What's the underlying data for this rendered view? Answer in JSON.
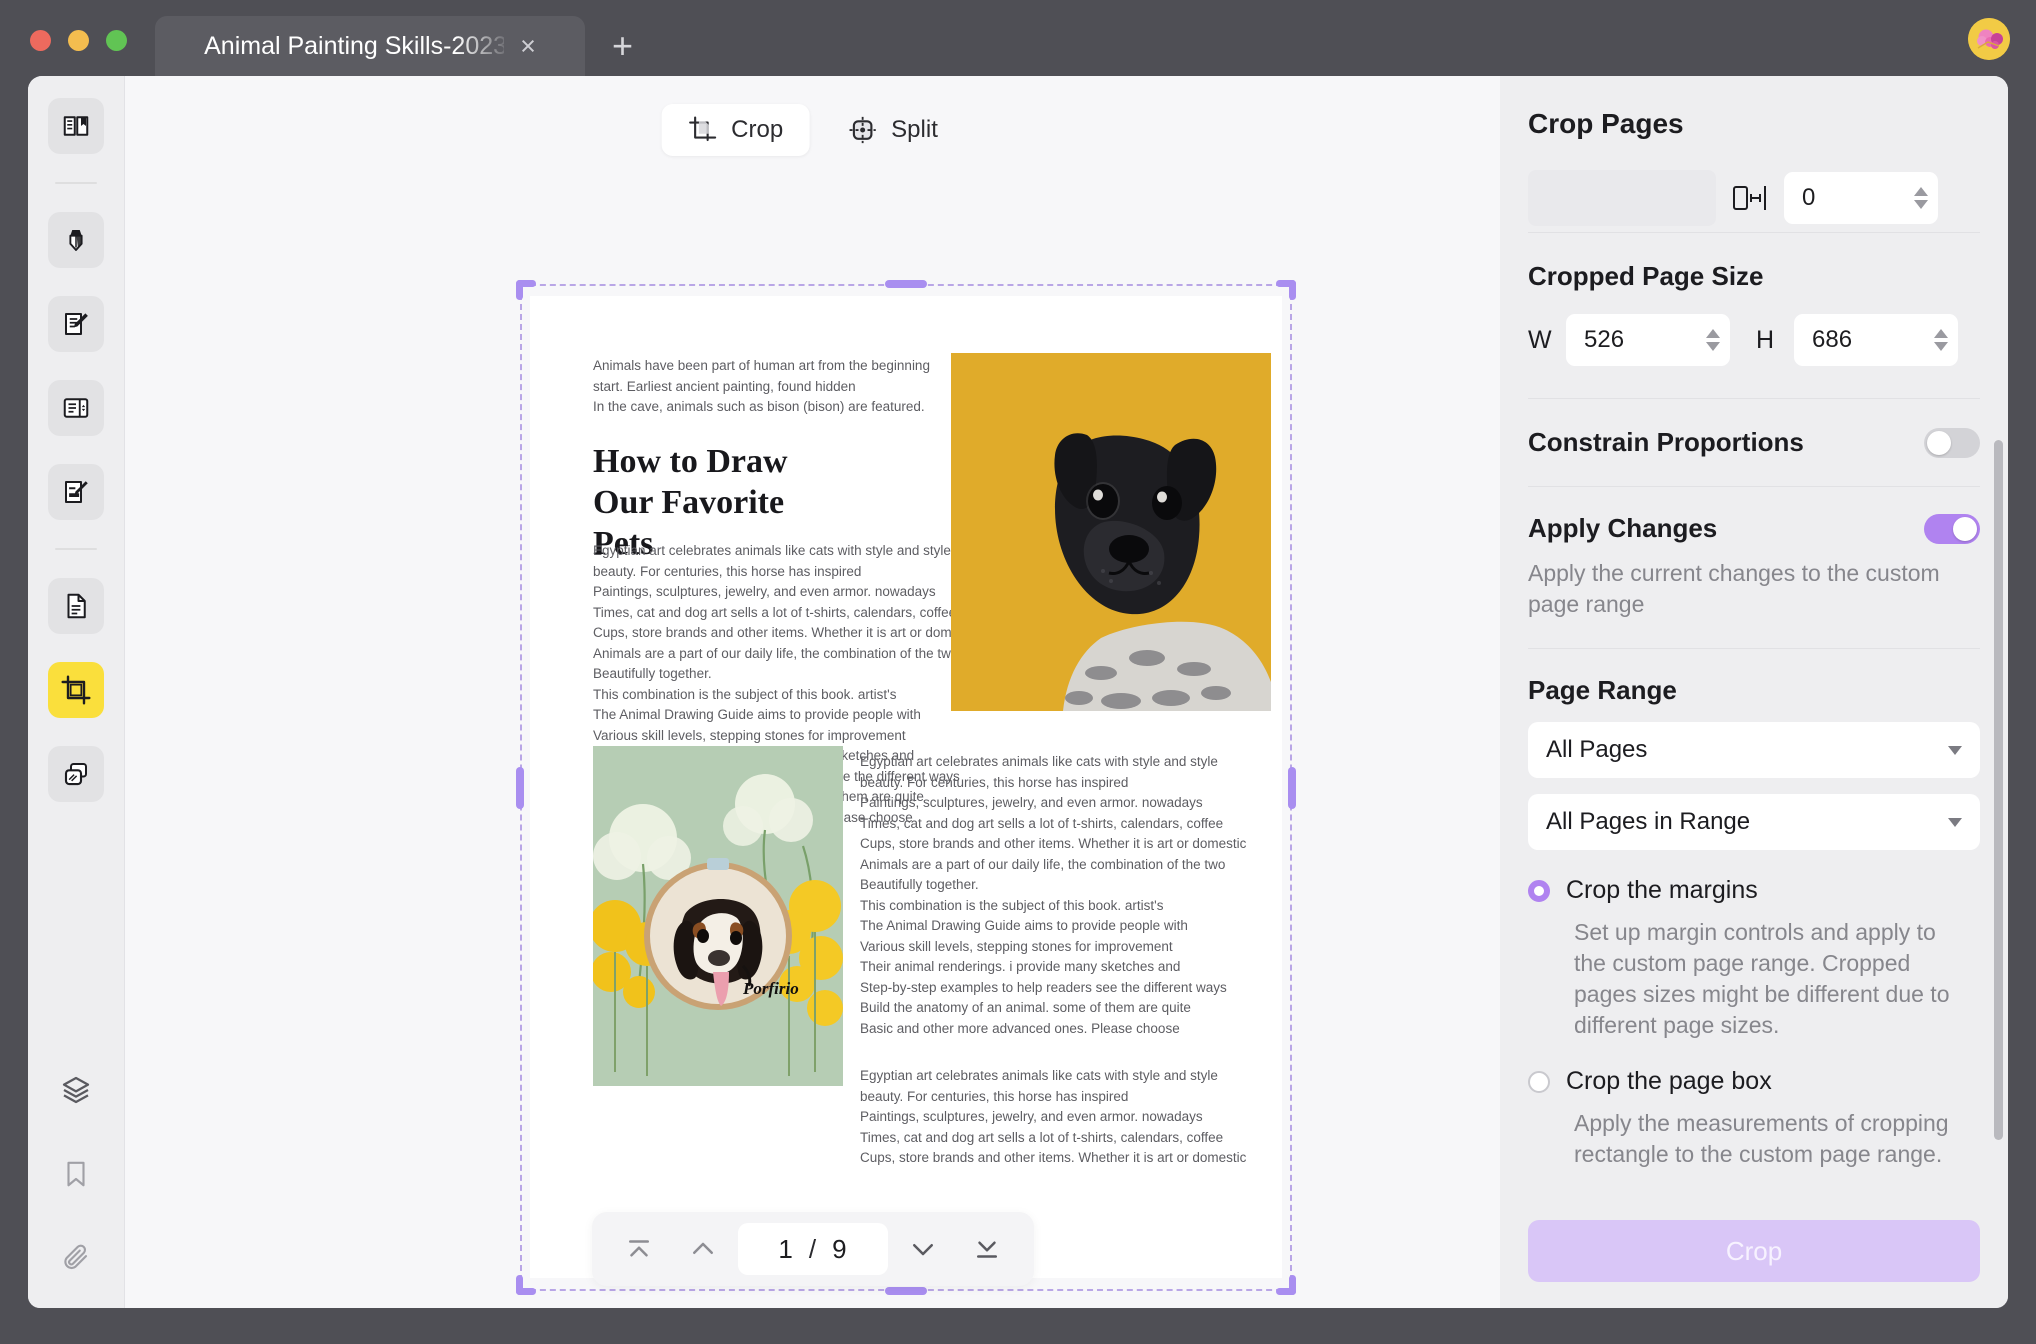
{
  "window": {
    "tab_title": "Animal Painting Skills-2023",
    "close_label": "×",
    "new_tab_label": "+"
  },
  "sidebar": {
    "items": [
      {
        "name": "reader-icon",
        "label": "Reader"
      },
      {
        "name": "highlighter-icon",
        "label": "Highlight"
      },
      {
        "name": "edit-text-icon",
        "label": "Edit Text"
      },
      {
        "name": "form-icon",
        "label": "Form"
      },
      {
        "name": "sign-icon",
        "label": "Sign"
      },
      {
        "name": "page-organize-icon",
        "label": "Organize Pages"
      },
      {
        "name": "crop-icon",
        "label": "Crop"
      },
      {
        "name": "background-icon",
        "label": "Background"
      },
      {
        "name": "layers-icon",
        "label": "Layers"
      },
      {
        "name": "bookmark-icon",
        "label": "Bookmarks"
      },
      {
        "name": "attachment-icon",
        "label": "Attachments"
      }
    ],
    "active_index": 6
  },
  "toolbar": {
    "crop_label": "Crop",
    "split_label": "Split",
    "active_mode": "Crop"
  },
  "document": {
    "intro_lines": [
      "Animals have been part of human art from the beginning",
      "start. Earliest ancient painting, found hidden",
      "In the cave, animals such as bison (bison) are featured."
    ],
    "title": "How to Draw Our Favorite Pets",
    "body_lines": [
      "Egyptian art celebrates animals like cats with style and style",
      "beauty. For centuries, this horse has inspired",
      "Paintings, sculptures, jewelry, and even armor. nowadays",
      "Times, cat and dog art sells a lot of t-shirts, calendars, coffee",
      "Cups, store brands and other items. Whether it is art or domestic",
      "Animals are a part of our daily life, the combination of the two",
      "Beautifully together.",
      "This combination is the subject of this book. artist's",
      "The Animal Drawing Guide aims to provide people with",
      "Various skill levels, stepping stones for improvement",
      "Their animal renderings. I provide many sketches and",
      "Step-by-step examples to help readers see the different ways",
      "Build the anatomy of an animal. some of them are quite",
      "Basic and other more advanced ones. Please choose"
    ],
    "lower_right_lines": [
      "Egyptian art celebrates animals like cats with style and style",
      "beauty. For centuries, this horse has inspired",
      "Paintings, sculptures, jewelry, and even armor. nowadays",
      "Times, cat and dog art sells a lot of t-shirts, calendars, coffee",
      "Cups, store brands and other items. Whether it is art or domestic",
      "Animals are a part of our daily life, the combination of the two",
      "Beautifully together.",
      "This combination is the subject of this book. artist's",
      "The Animal Drawing Guide aims to provide people with",
      "Various skill levels, stepping stones for improvement",
      "Their animal renderings. i provide many sketches and",
      "Step-by-step examples to help readers see the different ways",
      "Build the anatomy of an animal. some of them are quite",
      "Basic and other more advanced ones. Please choose"
    ],
    "lower_right_tail_lines": [
      "Egyptian art celebrates animals like cats with style and style",
      "beauty. For centuries, this horse has inspired",
      "Paintings, sculptures, jewelry, and even armor. nowadays",
      "Times, cat and dog art sells a lot of t-shirts, calendars, coffee",
      "Cups, store brands and other items. Whether it is art or domestic"
    ],
    "photo_pug_alt": "black pug on yellow background",
    "photo_embroidery_alt": "embroidered dog portrait with flowers",
    "embroidery_caption": "Porfirio"
  },
  "pagenav": {
    "first_label": "first-page",
    "prev_label": "previous-page",
    "current_page": "1",
    "separator": "/",
    "total_pages": "9",
    "next_label": "next-page",
    "last_label": "last-page"
  },
  "panel": {
    "title": "Crop Pages",
    "margin_value": "0",
    "cropped_size_title": "Cropped Page Size",
    "width_label": "W",
    "width_value": "526",
    "height_label": "H",
    "height_value": "686",
    "constrain_label": "Constrain Proportions",
    "constrain_on": false,
    "apply_changes_label": "Apply Changes",
    "apply_changes_on": true,
    "apply_changes_desc": "Apply the current changes to the custom page range",
    "page_range_title": "Page Range",
    "page_range_value": "All Pages",
    "page_subset_value": "All Pages in Range",
    "options": [
      {
        "label": "Crop the margins",
        "selected": true,
        "desc": "Set up margin controls and apply to the custom page range. Cropped pages sizes might be different due to different page sizes."
      },
      {
        "label": "Crop the page box",
        "selected": false,
        "desc": "Apply the measurements of cropping rectangle to the custom page range."
      }
    ],
    "crop_button_label": "Crop"
  },
  "colors": {
    "accent_purple": "#b083f0",
    "handle_purple": "#a98ef0",
    "active_yellow": "#fadf3c",
    "chrome_dark": "#4f4f55",
    "pug_bg": "#e0ab2a",
    "embroidery_bg": "#b6cdb4"
  }
}
